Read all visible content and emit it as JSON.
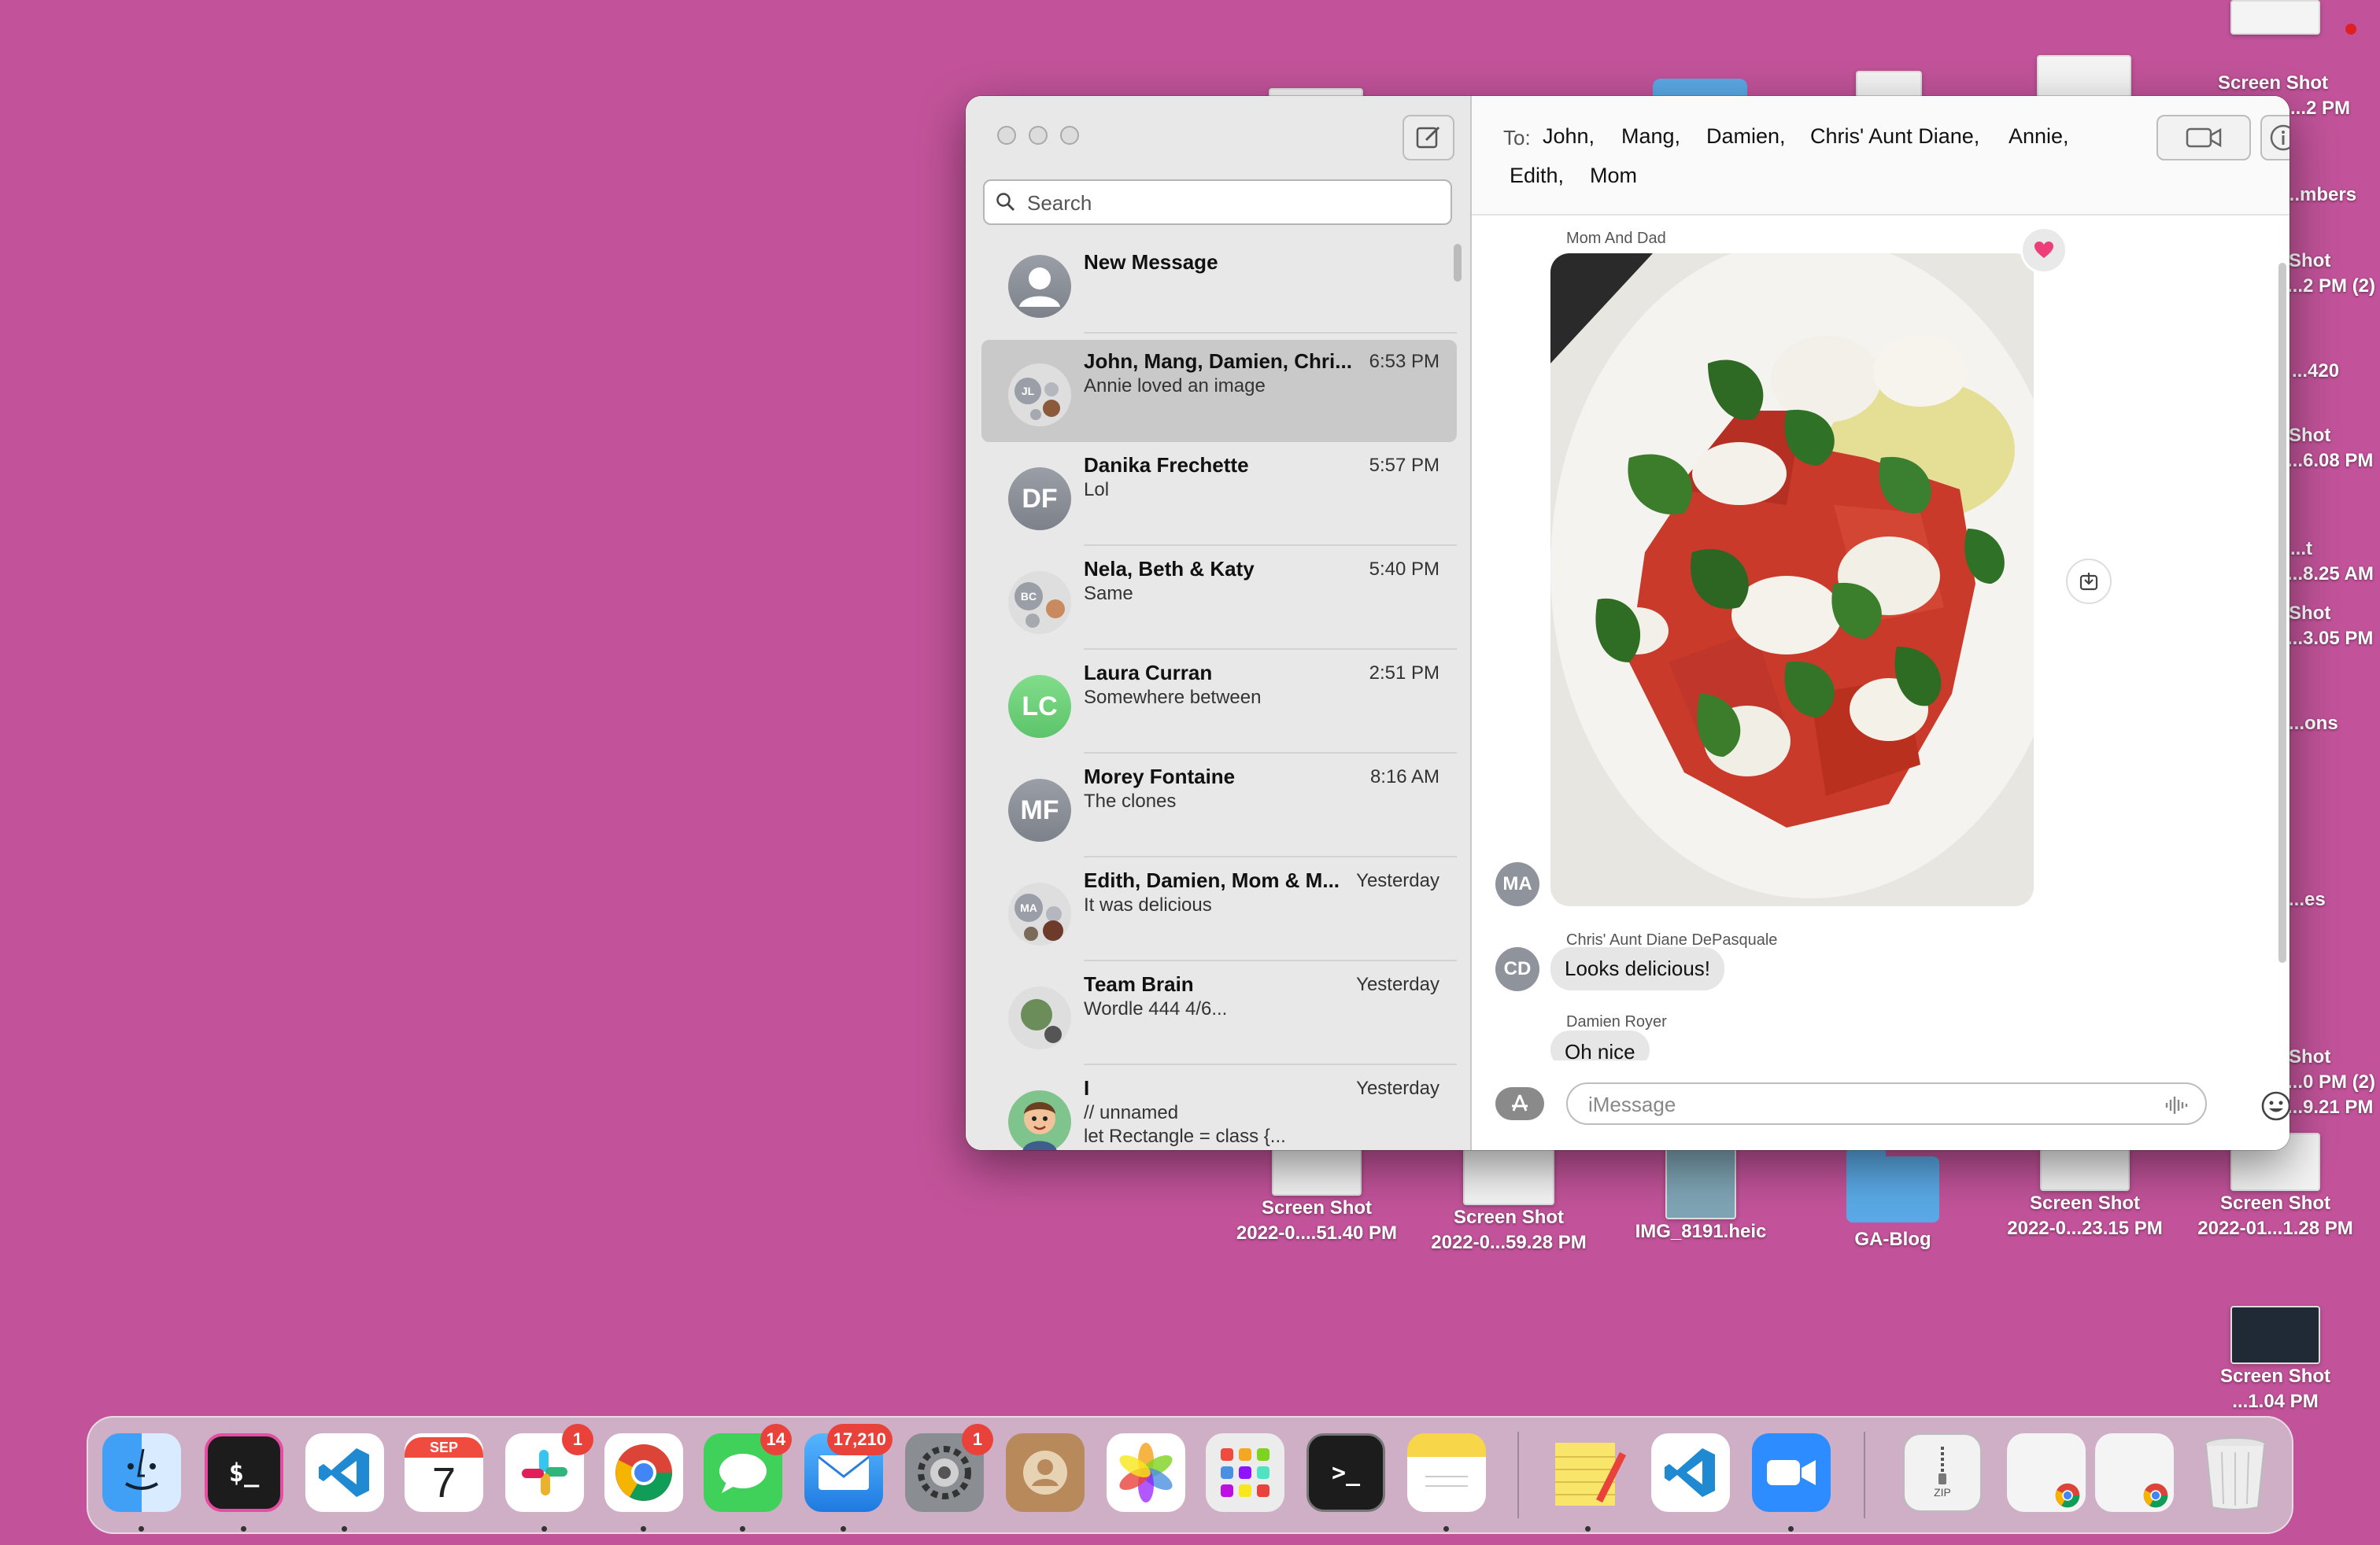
{
  "desktop": {
    "icons": [
      {
        "label_line1": "Screen Shot",
        "label_line2": "2022-0....51.40 PM"
      },
      {
        "label_line1": "Screen Shot",
        "label_line2": "2022-0...59.28 PM"
      },
      {
        "label_line1": "IMG_8191.heic",
        "label_line2": ""
      },
      {
        "label_line1": "GA-Blog",
        "label_line2": ""
      },
      {
        "label_line1": "Screen Shot",
        "label_line2": "2022-0...23.15 PM"
      },
      {
        "label_line1": "Screen Shot",
        "label_line2": "2022-01...1.28 PM"
      },
      {
        "label_line1": "Screen Shot",
        "label_line2": "...1.04 PM"
      }
    ],
    "edge_labels": [
      "Screen Shot",
      "...2 PM",
      "...mbers",
      "Shot",
      "...2 PM (2)",
      "...420",
      "Shot",
      "...6.08 PM",
      "...t",
      "...8.25 AM",
      "Shot",
      "...3.05 PM",
      "...ons",
      "...es",
      "Shot",
      "...0 PM (2)",
      "...9.21 PM"
    ]
  },
  "sidebar": {
    "search_placeholder": "Search",
    "conversations": [
      {
        "name": "New Message",
        "time": "",
        "preview": "",
        "avatar": "",
        "avatar_type": "person"
      },
      {
        "name": "John, Mang, Damien, Chri...",
        "time": "6:53 PM",
        "preview": "Annie loved an image",
        "avatar": "JL",
        "avatar_type": "group"
      },
      {
        "name": "Danika Frechette",
        "time": "5:57 PM",
        "preview": "Lol",
        "avatar": "DF",
        "avatar_type": "gray"
      },
      {
        "name": "Nela, Beth & Katy",
        "time": "5:40 PM",
        "preview": "Same",
        "avatar": "BC",
        "avatar_type": "group"
      },
      {
        "name": "Laura Curran",
        "time": "2:51 PM",
        "preview": "Somewhere between",
        "avatar": "LC",
        "avatar_type": "green"
      },
      {
        "name": "Morey Fontaine",
        "time": "8:16 AM",
        "preview": "The clones",
        "avatar": "MF",
        "avatar_type": "gray"
      },
      {
        "name": "Edith, Damien, Mom & M...",
        "time": "Yesterday",
        "preview": "It was delicious",
        "avatar": "MA",
        "avatar_type": "group"
      },
      {
        "name": "Team Brain",
        "time": "Yesterday",
        "preview": "Wordle 444 4/6...",
        "avatar": "",
        "avatar_type": "photo"
      },
      {
        "name": "I",
        "time": "Yesterday",
        "preview": "// unnamed\nlet Rectangle = class {...",
        "avatar": "",
        "avatar_type": "memoji"
      }
    ]
  },
  "chat": {
    "to_label": "To:",
    "recipients": [
      "John,",
      "Mang,",
      "Damien,",
      "Chris' Aunt Diane,",
      "Annie,",
      "Edith,",
      "Mom"
    ],
    "messages": [
      {
        "sender": "Mom And Dad",
        "avatar": "MA",
        "type": "image",
        "reaction": "heart"
      },
      {
        "sender": "Chris' Aunt Diane DePasquale",
        "avatar": "CD",
        "text": "Looks delicious!"
      },
      {
        "sender": "Damien Royer",
        "avatar": "",
        "text": "Oh nice"
      }
    ],
    "input_placeholder": "iMessage"
  },
  "dock": {
    "apps": [
      {
        "name": "Finder",
        "badge": ""
      },
      {
        "name": "iTerm",
        "badge": ""
      },
      {
        "name": "Visual Studio Code",
        "badge": ""
      },
      {
        "name": "Calendar",
        "badge": "",
        "month": "SEP",
        "day": "7"
      },
      {
        "name": "Slack",
        "badge": "1"
      },
      {
        "name": "Chrome",
        "badge": ""
      },
      {
        "name": "Messages",
        "badge": "14"
      },
      {
        "name": "Mail",
        "badge": "17,210"
      },
      {
        "name": "System Preferences",
        "badge": "1"
      },
      {
        "name": "Contacts",
        "badge": ""
      },
      {
        "name": "Photos",
        "badge": ""
      },
      {
        "name": "Launchpad",
        "badge": ""
      },
      {
        "name": "Terminal",
        "badge": ""
      },
      {
        "name": "Notes",
        "badge": ""
      },
      {
        "name": "Stickies",
        "badge": ""
      },
      {
        "name": "Visual Studio Code 2",
        "badge": ""
      },
      {
        "name": "Zoom",
        "badge": ""
      },
      {
        "name": "Archive",
        "badge": "",
        "label": "ZIP"
      },
      {
        "name": "Chrome Document 1",
        "badge": ""
      },
      {
        "name": "Chrome Document 2",
        "badge": ""
      },
      {
        "name": "Trash",
        "badge": ""
      }
    ]
  },
  "colors": {
    "desktop": "#c2539a",
    "badge": "#e8423a",
    "heart": "#ec3f7a"
  }
}
